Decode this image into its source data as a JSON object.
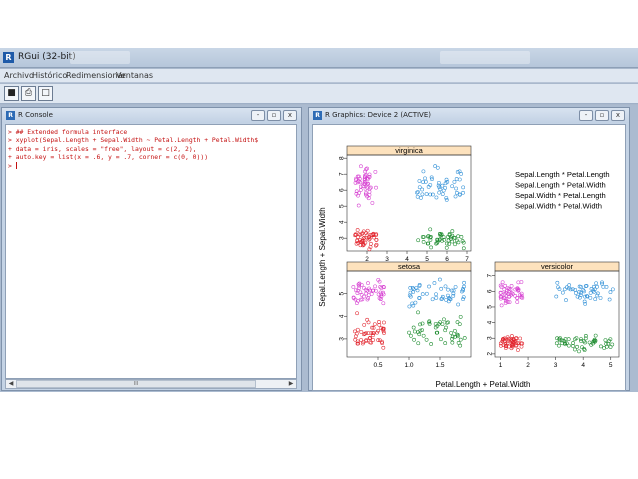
{
  "app": {
    "title": "RGui (32-bit)"
  },
  "menu": [
    "Archivo",
    "Histórico",
    "Redimensionar",
    "Ventanas"
  ],
  "toolbar": {
    "icons": [
      "open-script-icon",
      "print-icon",
      "window-icon"
    ]
  },
  "console": {
    "title": "R Console",
    "lines": [
      "> ## Extended formula interface",
      "> xyplot(Sepal.Length + Sepal.Width ~ Petal.Length + Petal.Width$",
      "+ data = iris, scales = \"free\", layout = c(2, 2),",
      "+ auto.key = list(x = .6, y = .7, corner = c(0, 0)))",
      ">"
    ],
    "scroll_label": "III"
  },
  "graphics": {
    "title": "R Graphics: Device 2 (ACTIVE)"
  },
  "window_buttons": {
    "minimize": "-",
    "restore": "▫",
    "close": "x"
  },
  "colors": {
    "magenta": "#d63fd1",
    "red": "#e2262f",
    "blue": "#2f8fd6",
    "green": "#1a8a2c",
    "strip": "#fde2bd"
  },
  "chart_data": {
    "type": "scatter",
    "xlabel": "Petal.Length + Petal.Width",
    "ylabel": "Sepal.Length + Sepal.Width",
    "legend": [
      "Sepal.Length * Petal.Length",
      "Sepal.Length * Petal.Width",
      "Sepal.Width * Petal.Length",
      "Sepal.Width * Petal.Width"
    ],
    "legend_placement": "top-right",
    "panels": [
      {
        "name": "virginica",
        "xlim": [
          1,
          7.2
        ],
        "ylim": [
          2.2,
          8.2
        ],
        "xticks": [
          "2",
          "3",
          "4",
          "5",
          "6",
          "7"
        ],
        "yticks": [
          "3",
          "4",
          "5",
          "6",
          "7",
          "8"
        ],
        "groups": [
          {
            "series": "Sepal.Length * Petal.Width",
            "x_range": [
              1.4,
              2.5
            ],
            "y_range": [
              4.9,
              7.9
            ],
            "count": 50
          },
          {
            "series": "Sepal.Length * Petal.Length",
            "x_range": [
              4.5,
              6.9
            ],
            "y_range": [
              4.9,
              7.9
            ],
            "count": 50
          },
          {
            "series": "Sepal.Width * Petal.Width",
            "x_range": [
              1.4,
              2.5
            ],
            "y_range": [
              2.2,
              3.8
            ],
            "count": 50
          },
          {
            "series": "Sepal.Width * Petal.Length",
            "x_range": [
              4.5,
              6.9
            ],
            "y_range": [
              2.2,
              3.8
            ],
            "count": 50
          }
        ]
      },
      {
        "name": "setosa",
        "xlim": [
          0,
          2
        ],
        "ylim": [
          2.2,
          6
        ],
        "xticks": [
          "0.5",
          "1.0",
          "1.5"
        ],
        "yticks": [
          "3",
          "4",
          "5"
        ],
        "groups": [
          {
            "series": "Sepal.Length * Petal.Width",
            "x_range": [
              0.1,
              0.6
            ],
            "y_range": [
              4.3,
              5.8
            ],
            "count": 50
          },
          {
            "series": "Sepal.Length * Petal.Length",
            "x_range": [
              1.0,
              1.9
            ],
            "y_range": [
              4.3,
              5.8
            ],
            "count": 50
          },
          {
            "series": "Sepal.Width * Petal.Width",
            "x_range": [
              0.1,
              0.6
            ],
            "y_range": [
              2.3,
              4.4
            ],
            "count": 50
          },
          {
            "series": "Sepal.Width * Petal.Length",
            "x_range": [
              1.0,
              1.9
            ],
            "y_range": [
              2.3,
              4.4
            ],
            "count": 50
          }
        ]
      },
      {
        "name": "versicolor",
        "xlim": [
          0.8,
          5.3
        ],
        "ylim": [
          1.8,
          7.3
        ],
        "xticks": [
          "1",
          "2",
          "3",
          "4",
          "5"
        ],
        "yticks": [
          "2",
          "3",
          "4",
          "5",
          "6",
          "7"
        ],
        "groups": [
          {
            "series": "Sepal.Length * Petal.Width",
            "x_range": [
              1.0,
              1.8
            ],
            "y_range": [
              4.9,
              7.0
            ],
            "count": 50
          },
          {
            "series": "Sepal.Length * Petal.Length",
            "x_range": [
              3.0,
              5.1
            ],
            "y_range": [
              4.9,
              7.0
            ],
            "count": 50
          },
          {
            "series": "Sepal.Width * Petal.Width",
            "x_range": [
              1.0,
              1.8
            ],
            "y_range": [
              2.0,
              3.4
            ],
            "count": 50
          },
          {
            "series": "Sepal.Width * Petal.Length",
            "x_range": [
              3.0,
              5.1
            ],
            "y_range": [
              2.0,
              3.4
            ],
            "count": 50
          }
        ]
      }
    ]
  }
}
